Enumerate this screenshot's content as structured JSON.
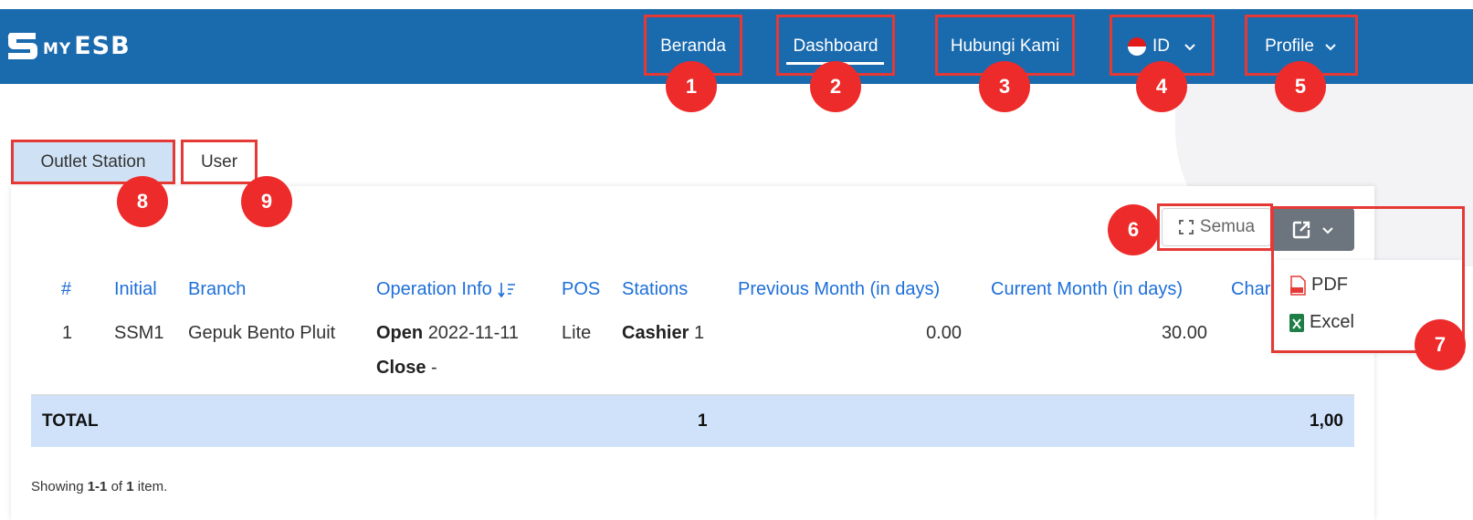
{
  "brand": {
    "my": "MY",
    "esb": "ESB"
  },
  "nav": {
    "beranda": "Beranda",
    "dashboard": "Dashboard",
    "hubungi": "Hubungi Kami",
    "language": "ID",
    "profile": "Profile"
  },
  "markers": [
    "1",
    "2",
    "3",
    "4",
    "5",
    "6",
    "7",
    "8",
    "9"
  ],
  "tabs": {
    "outlet": "Outlet Station",
    "user": "User"
  },
  "toolbar": {
    "semua": "Semua",
    "export_options": [
      "PDF",
      "Excel"
    ]
  },
  "table": {
    "headers": {
      "no": "#",
      "initial": "Initial",
      "branch": "Branch",
      "operation": "Operation Info",
      "pos": "POS",
      "stations": "Stations",
      "prev_month": "Previous Month (in days)",
      "curr_month": "Current Month (in days)",
      "charge": "Char"
    },
    "rows": [
      {
        "no": "1",
        "initial": "SSM1",
        "branch": "Gepuk Bento Pluit",
        "open_label": "Open",
        "open_value": "2022-11-11",
        "close_label": "Close",
        "close_value": "-",
        "pos": "Lite",
        "station_label": "Cashier",
        "station_count": "1",
        "prev_month": "0.00",
        "curr_month": "30.00"
      }
    ],
    "total": {
      "label": "TOTAL",
      "stations": "1",
      "charge": "1,00"
    }
  },
  "pagination": {
    "prefix": "Showing ",
    "range": "1-1",
    "of": " of ",
    "count": "1",
    "suffix": " item."
  },
  "colors": {
    "navbar": "#1a6aae",
    "link_blue": "#1e6fd9",
    "annotation_red": "#e53935",
    "total_row": "#cfe2fa",
    "active_tab": "#cfe2f5",
    "export_button": "#6c757d"
  },
  "icons": {
    "logo": "esb-logo-icon",
    "flag": "indonesia-flag-icon",
    "chevron": "chevron-down-icon",
    "sort": "sort-desc-icon",
    "fullscreen": "fullscreen-icon",
    "export": "external-link-icon",
    "pdf": "pdf-file-icon",
    "excel": "excel-file-icon"
  }
}
